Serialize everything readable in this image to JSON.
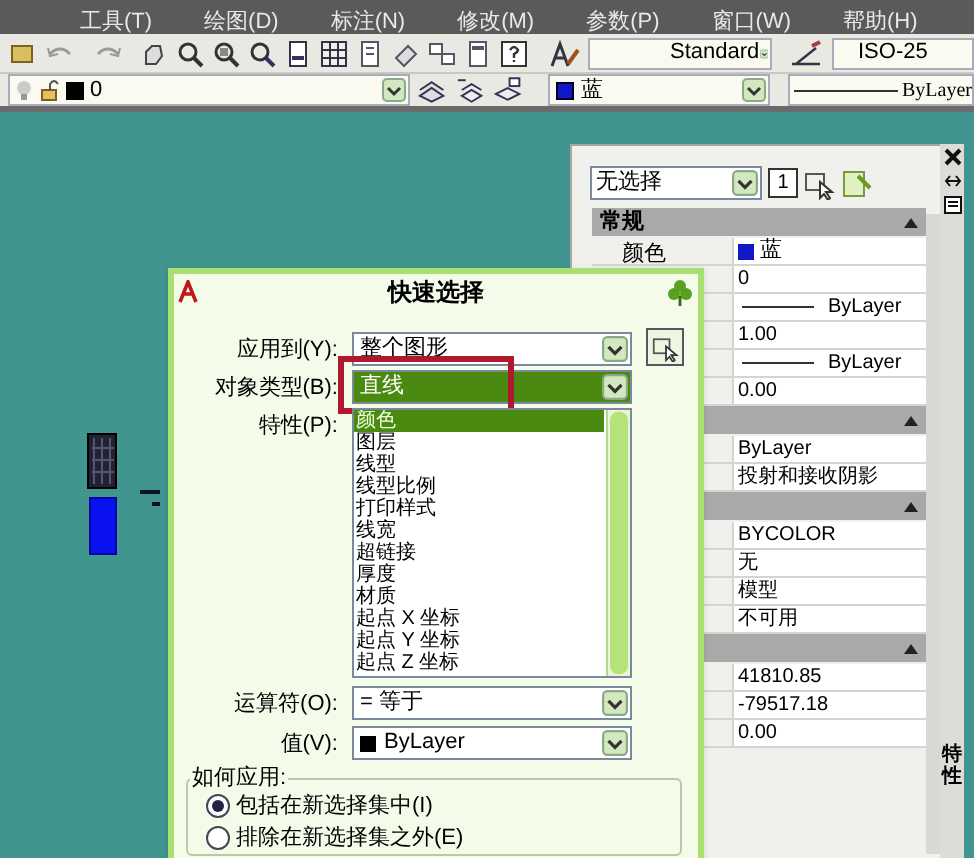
{
  "menu_bar": {
    "items": [
      "工具(T)",
      "绘图(D)",
      "标注(N)",
      "修改(M)",
      "参数(P)",
      "窗口(W)",
      "帮助(H)"
    ]
  },
  "toolbar": {
    "text_style": "Standard",
    "dim_style": "ISO-25"
  },
  "layer_bar": {
    "layer": "0",
    "color_name": "蓝",
    "linetype": "ByLayer"
  },
  "properties_palette": {
    "selection": "无选择",
    "count_button": "1",
    "side_title": "特性",
    "sections": [
      {
        "title": "常规",
        "expanded": true,
        "rows": [
          {
            "kind": "color",
            "label": "颜色",
            "value": "蓝"
          },
          {
            "kind": "text",
            "value": "0"
          },
          {
            "kind": "line",
            "value": "ByLayer"
          },
          {
            "kind": "text",
            "value": "1.00"
          },
          {
            "kind": "line",
            "value": "ByLayer"
          },
          {
            "kind": "text",
            "value": "0.00"
          }
        ]
      },
      {
        "expanded": true,
        "rows": [
          {
            "kind": "text",
            "value": "ByLayer"
          },
          {
            "kind": "text",
            "value": "投射和接收阴影"
          }
        ]
      },
      {
        "expanded": true,
        "rows": [
          {
            "kind": "text",
            "value": "BYCOLOR"
          },
          {
            "kind": "text",
            "value": "无"
          },
          {
            "kind": "text",
            "value": "模型"
          },
          {
            "kind": "text",
            "value": "不可用"
          }
        ]
      },
      {
        "expanded": true,
        "rows": [
          {
            "kind": "text",
            "value": "41810.85"
          },
          {
            "kind": "text",
            "value": "-79517.18"
          },
          {
            "kind": "text",
            "value": "0.00"
          }
        ]
      }
    ]
  },
  "dialog": {
    "title": "快速选择",
    "apply_to": {
      "label": "应用到(Y):",
      "value": "整个图形"
    },
    "object_type": {
      "label": "对象类型(B):",
      "value": "直线",
      "highlighted": true
    },
    "properties": {
      "label": "特性(P):",
      "items": [
        {
          "label": "颜色",
          "selected": true
        },
        {
          "label": "图层",
          "selected": false
        },
        {
          "label": "线型",
          "selected": false
        },
        {
          "label": "线型比例",
          "selected": false
        },
        {
          "label": "打印样式",
          "selected": false
        },
        {
          "label": "线宽",
          "selected": false
        },
        {
          "label": "超链接",
          "selected": false
        },
        {
          "label": "厚度",
          "selected": false
        },
        {
          "label": "材质",
          "selected": false
        },
        {
          "label": "起点 X 坐标",
          "selected": false
        },
        {
          "label": "起点 Y 坐标",
          "selected": false
        },
        {
          "label": "起点 Z 坐标",
          "selected": false
        }
      ]
    },
    "operator": {
      "label": "运算符(O):",
      "value": "= 等于"
    },
    "value": {
      "label": "值(V):",
      "value": "ByLayer"
    },
    "apply_group": {
      "label": "如何应用:",
      "options": [
        {
          "label": "包括在新选择集中(I)",
          "selected": true
        },
        {
          "label": "排除在新选择集之外(E)",
          "selected": false
        }
      ]
    }
  }
}
